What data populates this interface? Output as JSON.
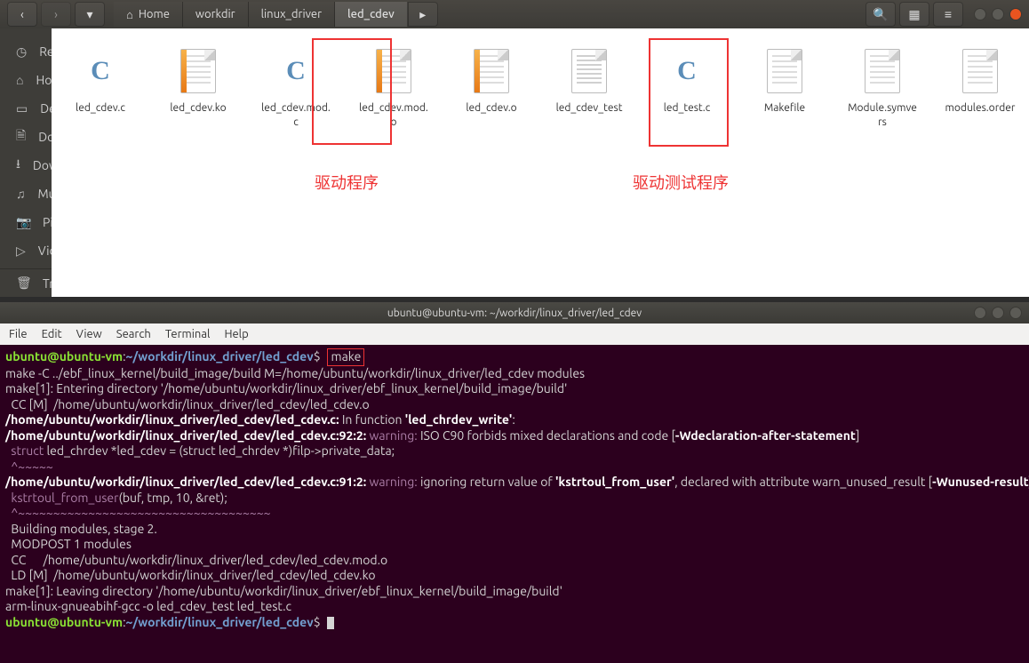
{
  "file_manager": {
    "toolbar": {
      "breadcrumbs": [
        "Home",
        "workdir",
        "linux_driver",
        "led_cdev"
      ],
      "active_crumb_index": 3
    },
    "sidebar": {
      "items": [
        {
          "icon": "◷",
          "label": "Recent"
        },
        {
          "icon": "⌂",
          "label": "Home"
        },
        {
          "icon": "▭",
          "label": "Desktop"
        },
        {
          "icon": "🗎",
          "label": "Documents"
        },
        {
          "icon": "⭳",
          "label": "Downloads"
        },
        {
          "icon": "♫",
          "label": "Music"
        },
        {
          "icon": "📷",
          "label": "Pictures"
        },
        {
          "icon": "▷",
          "label": "Videos"
        },
        {
          "icon": "🗑",
          "label": "Trash"
        }
      ]
    },
    "files": [
      {
        "name": "led_cdev.c",
        "icon": "c"
      },
      {
        "name": "led_cdev.ko",
        "icon": "ko"
      },
      {
        "name": "led_cdev.mod.c",
        "icon": "c"
      },
      {
        "name": "led_cdev.mod.o",
        "icon": "ko"
      },
      {
        "name": "led_cdev.o",
        "icon": "ko"
      },
      {
        "name": "led_cdev_test",
        "icon": "bin"
      },
      {
        "name": "led_test.c",
        "icon": "c"
      },
      {
        "name": "Makefile",
        "icon": "txt"
      },
      {
        "name": "Module.symvers",
        "icon": "txt"
      },
      {
        "name": "modules.order",
        "icon": "txt"
      }
    ],
    "annotations": {
      "a1": "驱动程序",
      "a2": "驱动测试程序"
    }
  },
  "terminal": {
    "title": "ubuntu@ubuntu-vm: ~/workdir/linux_driver/led_cdev",
    "menu": [
      "File",
      "Edit",
      "View",
      "Search",
      "Terminal",
      "Help"
    ],
    "prompt": {
      "user": "ubuntu",
      "host": "ubuntu-vm",
      "path": "~/workdir/linux_driver/led_cdev",
      "symbol": "$"
    },
    "command": "make",
    "lines": {
      "l1": "make -C ../ebf_linux_kernel/build_image/build M=/home/ubuntu/workdir/linux_driver/led_cdev modules",
      "l2": "make[1]: Entering directory '/home/ubuntu/workdir/linux_driver/ebf_linux_kernel/build_image/build'",
      "l3": "  CC [M]  /home/ubuntu/workdir/linux_driver/led_cdev/led_cdev.o",
      "l4a": "/home/ubuntu/workdir/linux_driver/led_cdev/led_cdev.c:",
      "l4b": " In function ",
      "l4c": "'led_chrdev_write'",
      "l4d": ":",
      "l5a": "/home/ubuntu/workdir/linux_driver/led_cdev/led_cdev.c:92:2: ",
      "l5b": "warning: ",
      "l5c": "ISO C90 forbids mixed declarations and code [",
      "l5d": "-Wdeclaration-after-statement",
      "l5e": "]",
      "l6a": "  struct ",
      "l6b": "led_chrdev *led_cdev = (struct led_chrdev *)filp->private_data;",
      "l7": "  ^~~~~~",
      "l8a": "/home/ubuntu/workdir/linux_driver/led_cdev/led_cdev.c:91:2: ",
      "l8b": "warning: ",
      "l8c": "ignoring return value of ",
      "l8d": "'kstrtoul_from_user'",
      "l8e": ", declared with attribute warn_unused_result [",
      "l8f": "-Wunused-result",
      "l8g": "]",
      "l9a": "  kstrtoul_from_user",
      "l9b": "(buf, tmp, 10, &ret);",
      "l10": "  ^~~~~~~~~~~~~~~~~~~~~~~~~~~~~~~~~~~~~",
      "l11": "  Building modules, stage 2.",
      "l12": "  MODPOST 1 modules",
      "l13": "  CC      /home/ubuntu/workdir/linux_driver/led_cdev/led_cdev.mod.o",
      "l14": "  LD [M]  /home/ubuntu/workdir/linux_driver/led_cdev/led_cdev.ko",
      "l15": "make[1]: Leaving directory '/home/ubuntu/workdir/linux_driver/ebf_linux_kernel/build_image/build'",
      "l16": "arm-linux-gnueabihf-gcc -o led_cdev_test led_test.c"
    }
  }
}
